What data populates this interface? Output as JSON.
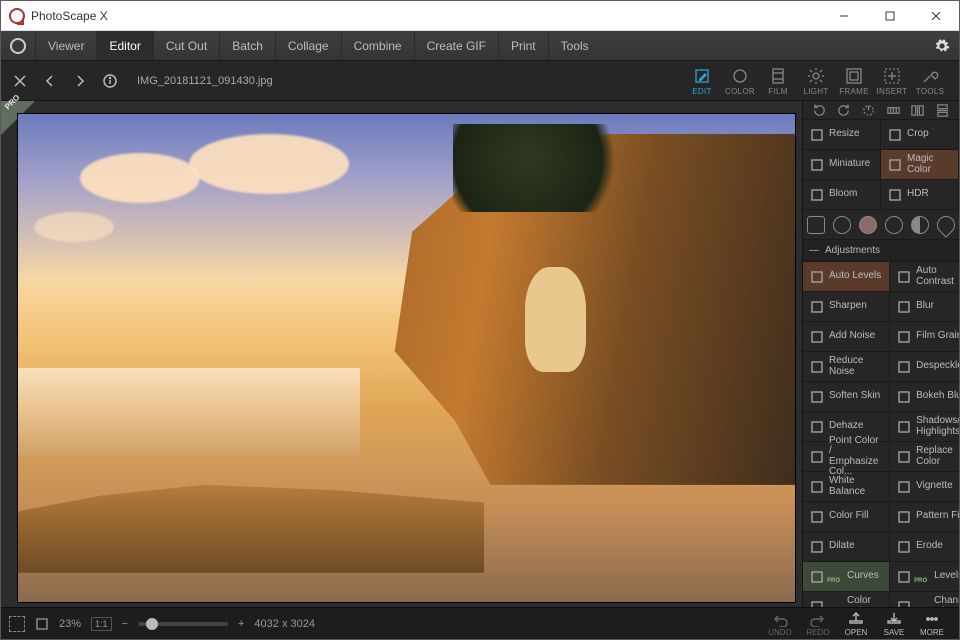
{
  "window": {
    "title": "PhotoScape X"
  },
  "mainTabs": [
    "Viewer",
    "Editor",
    "Cut Out",
    "Batch",
    "Collage",
    "Combine",
    "Create GIF",
    "Print",
    "Tools"
  ],
  "mainTabActive": "Editor",
  "file": {
    "name": "IMG_20181121_091430.jpg"
  },
  "topTools": [
    {
      "id": "edit",
      "label": "EDIT"
    },
    {
      "id": "color",
      "label": "COLOR"
    },
    {
      "id": "film",
      "label": "FILM"
    },
    {
      "id": "light",
      "label": "LIGHT"
    },
    {
      "id": "frame",
      "label": "FRAME"
    },
    {
      "id": "insert",
      "label": "INSERT"
    },
    {
      "id": "tools",
      "label": "TOOLS"
    }
  ],
  "topToolActive": "edit",
  "transformTools": [
    {
      "id": "resize",
      "label": "Resize"
    },
    {
      "id": "crop",
      "label": "Crop"
    },
    {
      "id": "miniature",
      "label": "Miniature"
    },
    {
      "id": "magic-color",
      "label": "Magic Color",
      "hl": true
    },
    {
      "id": "bloom",
      "label": "Bloom"
    },
    {
      "id": "hdr",
      "label": "HDR"
    }
  ],
  "adjHeader": "Adjustments",
  "adjustTools": [
    {
      "id": "auto-levels",
      "label": "Auto Levels",
      "hl": true
    },
    {
      "id": "auto-contrast",
      "label": "Auto Contrast"
    },
    {
      "id": "sharpen",
      "label": "Sharpen"
    },
    {
      "id": "blur",
      "label": "Blur"
    },
    {
      "id": "add-noise",
      "label": "Add Noise"
    },
    {
      "id": "film-grain",
      "label": "Film Grain"
    },
    {
      "id": "reduce-noise",
      "label": "Reduce Noise"
    },
    {
      "id": "despeckle",
      "label": "Despeckle"
    },
    {
      "id": "soften-skin",
      "label": "Soften Skin"
    },
    {
      "id": "bokeh-blur",
      "label": "Bokeh Blur"
    },
    {
      "id": "dehaze",
      "label": "Dehaze"
    },
    {
      "id": "shadows-highlights",
      "label": "Shadows/\nHighlights"
    },
    {
      "id": "point-color",
      "label": "Point Color /\nEmphasize Col..."
    },
    {
      "id": "replace-color",
      "label": "Replace Color"
    },
    {
      "id": "white-balance",
      "label": "White Balance"
    },
    {
      "id": "vignette",
      "label": "Vignette"
    },
    {
      "id": "color-fill",
      "label": "Color Fill"
    },
    {
      "id": "pattern-fill",
      "label": "Pattern Fill"
    },
    {
      "id": "dilate",
      "label": "Dilate"
    },
    {
      "id": "erode",
      "label": "Erode"
    },
    {
      "id": "curves",
      "label": "Curves",
      "pro": true,
      "sel": true
    },
    {
      "id": "levels",
      "label": "Levels",
      "pro": true
    },
    {
      "id": "color-balance",
      "label": "Color Balance",
      "pro": true
    },
    {
      "id": "channel-mixer",
      "label": "Channel Mixer",
      "pro": true
    }
  ],
  "status": {
    "zoom": "23%",
    "fit": "1:1",
    "minus": "−",
    "plus": "+",
    "dimensions": "4032 x 3024"
  },
  "bottomTools": [
    {
      "id": "undo",
      "label": "UNDO",
      "on": false
    },
    {
      "id": "redo",
      "label": "REDO",
      "on": false
    },
    {
      "id": "open",
      "label": "OPEN",
      "on": true
    },
    {
      "id": "save",
      "label": "SAVE",
      "on": true
    },
    {
      "id": "more",
      "label": "MORE",
      "on": true
    }
  ]
}
